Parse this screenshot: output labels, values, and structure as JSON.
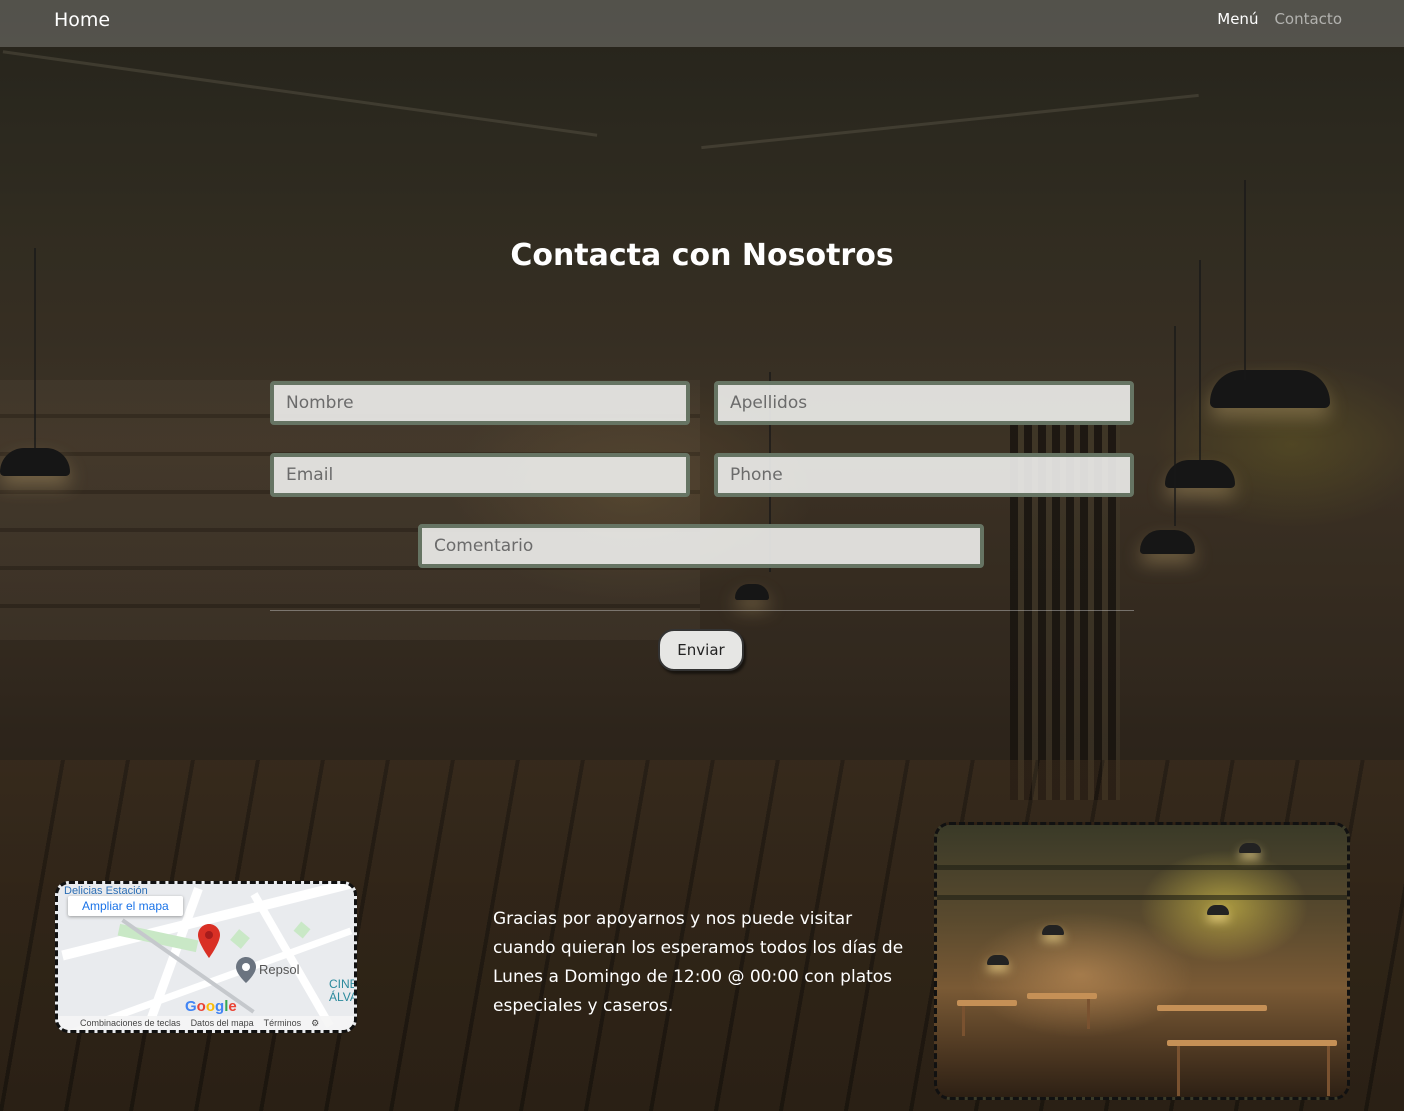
{
  "nav": {
    "brand": "Home",
    "links": [
      {
        "label": "Menú"
      },
      {
        "label": "Contacto"
      }
    ]
  },
  "page_title": "Contacta con Nosotros",
  "form": {
    "nombre": {
      "placeholder": "Nombre",
      "value": ""
    },
    "apellidos": {
      "placeholder": "Apellidos",
      "value": ""
    },
    "email": {
      "placeholder": "Email",
      "value": ""
    },
    "phone": {
      "placeholder": "Phone",
      "value": ""
    },
    "comentario": {
      "placeholder": "Comentario",
      "value": ""
    },
    "submit_label": "Enviar"
  },
  "map": {
    "expand_label": "Ampliar el mapa",
    "top_place": "Delicias Estación",
    "poi_label": "Repsol",
    "cine_label_1": "CINE",
    "cine_label_2": "ÁLVA",
    "logo": [
      "G",
      "o",
      "o",
      "g",
      "l",
      "e"
    ],
    "footer": {
      "shortcuts": "Combinaciones de teclas",
      "data": "Datos del mapa",
      "terms": "Términos"
    },
    "pin_color": "#d93025"
  },
  "thanks_text": "Gracias por apoyarnos y nos puede visitar cuando quieran los esperamos todos los días de Lunes a Domingo de 12:00 @ 00:00 con platos especiales y caseros.",
  "colors": {
    "field_border": "#667463",
    "navbar_bg": "rgba(140,140,135,0.45)"
  }
}
